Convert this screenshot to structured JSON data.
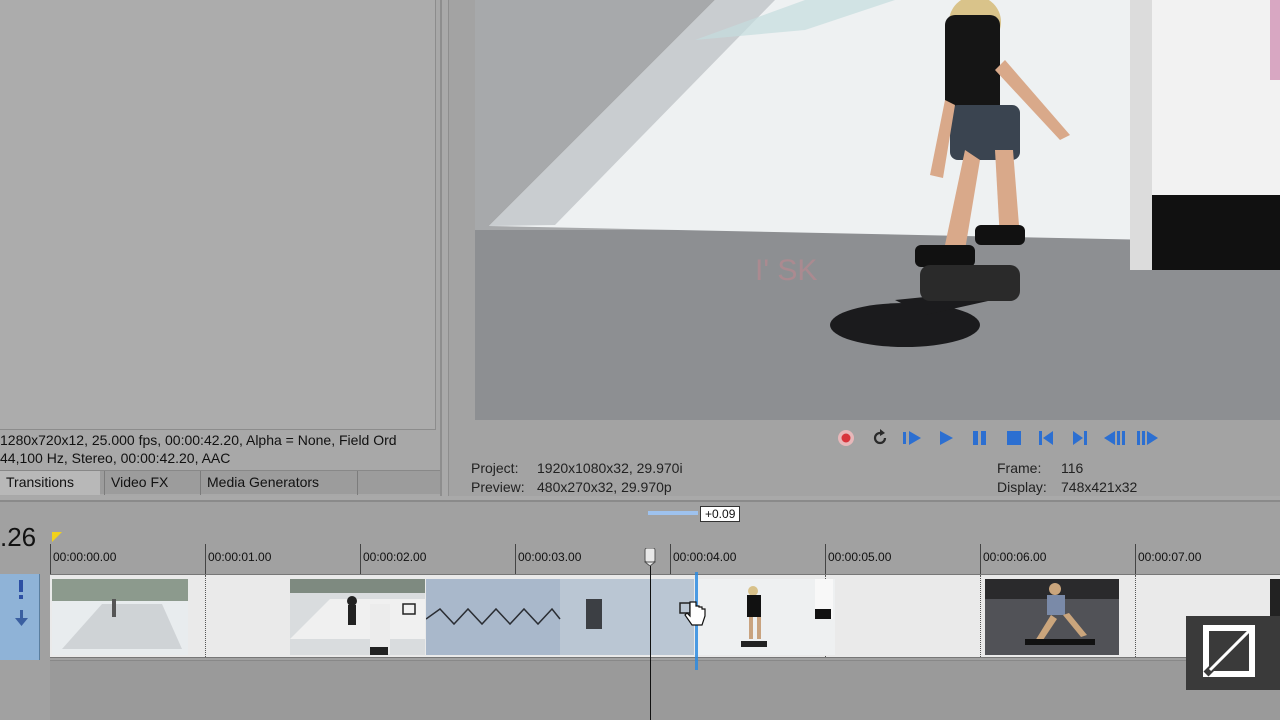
{
  "explorer": {
    "info_video": "1280x720x12, 25.000 fps, 00:00:42.20, Alpha = None, Field Ord",
    "info_audio": "44,100 Hz, Stereo, 00:00:42.20, AAC",
    "tabs": [
      "Transitions",
      "Video FX",
      "Media Generators"
    ]
  },
  "preview": {
    "project_label": "Project:",
    "project_value": "1920x1080x32, 29.970i",
    "preview_label": "Preview:",
    "preview_value": "480x270x32, 29.970p",
    "frame_label": "Frame:",
    "frame_value": "116",
    "display_label": "Display:",
    "display_value": "748x421x32",
    "transport": [
      "record-icon",
      "loop-icon",
      "play-from-start-icon",
      "play-icon",
      "pause-icon",
      "stop-icon",
      "go-to-start-icon",
      "go-to-end-icon",
      "previous-frame-icon",
      "next-frame-icon"
    ]
  },
  "timeline": {
    "timecode": ".26",
    "offset_badge": "+0.09",
    "ruler": [
      "00:00:00.00",
      "00:00:01.00",
      "00:00:02.00",
      "00:00:03.00",
      "00:00:04.00",
      "00:00:05.00",
      "00:00:06.00",
      "00:00:07.00"
    ],
    "track_header_icons": [
      "exclamation-icon",
      "arrow-down-icon"
    ]
  },
  "colors": {
    "accent_blue": "#2d8be0",
    "record_red": "#d8343c",
    "track_header": "#8fb3d7",
    "transport_blue": "#2c6fd1"
  }
}
